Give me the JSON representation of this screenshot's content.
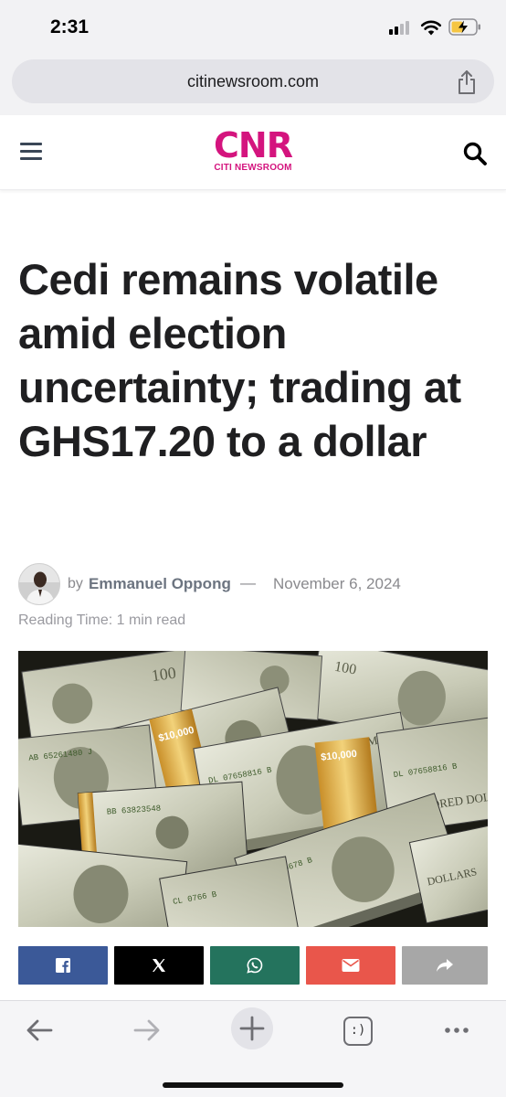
{
  "status_bar": {
    "time": "2:31"
  },
  "browser": {
    "url": "citinewsroom.com",
    "share_icon": "share-icon"
  },
  "site": {
    "logo_letters": "CNR",
    "logo_subtitle": "CITI NEWSROOM",
    "brand_color": "#d4147e",
    "menu_icon": "hamburger-menu-icon",
    "search_icon": "search-icon"
  },
  "article": {
    "headline": "Cedi remains volatile amid election uncertainty; trading at GHS17.20 to a dollar",
    "by_word": "by",
    "author": "Emmanuel Oppong",
    "separator": "—",
    "date": "November 6, 2024",
    "reading_time": "Reading Time: 1 min read"
  },
  "share_buttons": [
    {
      "name": "facebook",
      "icon": "facebook-icon",
      "color": "#3b5998"
    },
    {
      "name": "x",
      "icon": "x-icon",
      "color": "#000000"
    },
    {
      "name": "whatsapp",
      "icon": "whatsapp-icon",
      "color": "#24735d"
    },
    {
      "name": "email",
      "icon": "email-icon",
      "color": "#e9564b"
    },
    {
      "name": "share",
      "icon": "share-arrow-icon",
      "color": "#a7a7a7"
    }
  ],
  "toolbar": {
    "back_icon": "back-arrow-icon",
    "forward_icon": "forward-arrow-icon",
    "new_tab_icon": "plus-icon",
    "tabs_label": ":)",
    "more_icon": "more-icon"
  }
}
